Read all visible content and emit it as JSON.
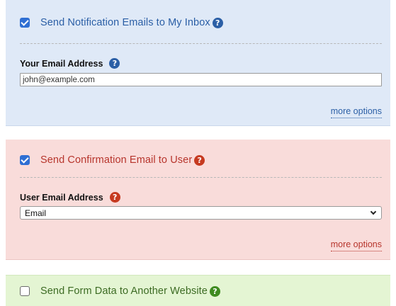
{
  "notification_panel": {
    "checkbox_checked": true,
    "title": "Send Notification Emails to My Inbox",
    "help_icon": "?",
    "field_label": "Your Email Address",
    "field_help_icon": "?",
    "email_value": "john@example.com",
    "more_options": "more options",
    "background": "#dfe9f7",
    "accent": "#2b5fa6"
  },
  "confirmation_panel": {
    "checkbox_checked": true,
    "title": "Send Confirmation Email to User",
    "help_icon": "?",
    "field_label": "User Email Address",
    "field_help_icon": "?",
    "select_value": "Email",
    "more_options": "more options",
    "background": "#f9dcda",
    "accent": "#b7352c"
  },
  "webhook_panel": {
    "checkbox_checked": false,
    "title": "Send Form Data to Another Website",
    "help_icon": "?",
    "background": "#e4f5d3",
    "accent": "#3f8b20"
  },
  "icons": {
    "help": "question-circle-icon",
    "checkbox_checked": "checkmark-icon",
    "select_arrow": "chevron-down-icon"
  }
}
